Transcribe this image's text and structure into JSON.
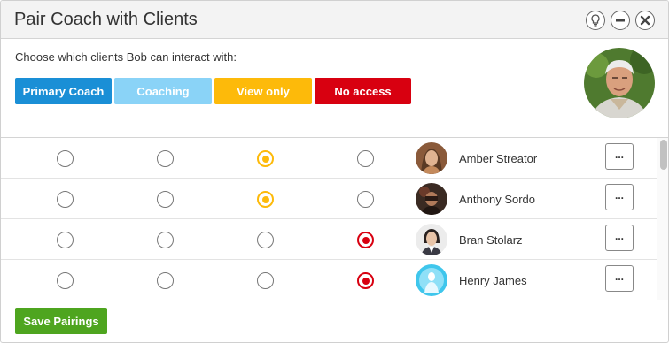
{
  "dialog": {
    "title": "Pair Coach with Clients",
    "header_icons": [
      "lightbulb-icon",
      "minimize-icon",
      "close-icon"
    ]
  },
  "intro": "Choose which clients Bob can interact with:",
  "legend": [
    {
      "label": "Primary Coach",
      "color": "#1a8fd6"
    },
    {
      "label": "Coaching",
      "color": "#8ad3f7"
    },
    {
      "label": "View only",
      "color": "#fdba0a"
    },
    {
      "label": "No access",
      "color": "#d80010"
    }
  ],
  "clients": [
    {
      "name": "Amber Streator",
      "selected": "View only",
      "more_label": "..."
    },
    {
      "name": "Anthony Sordo",
      "selected": "View only",
      "more_label": "..."
    },
    {
      "name": "Bran Stolarz",
      "selected": "No access",
      "more_label": "..."
    },
    {
      "name": "Henry James",
      "selected": "No access",
      "more_label": "..."
    }
  ],
  "footer": {
    "save_label": "Save Pairings",
    "save_color": "#4ea51f"
  }
}
